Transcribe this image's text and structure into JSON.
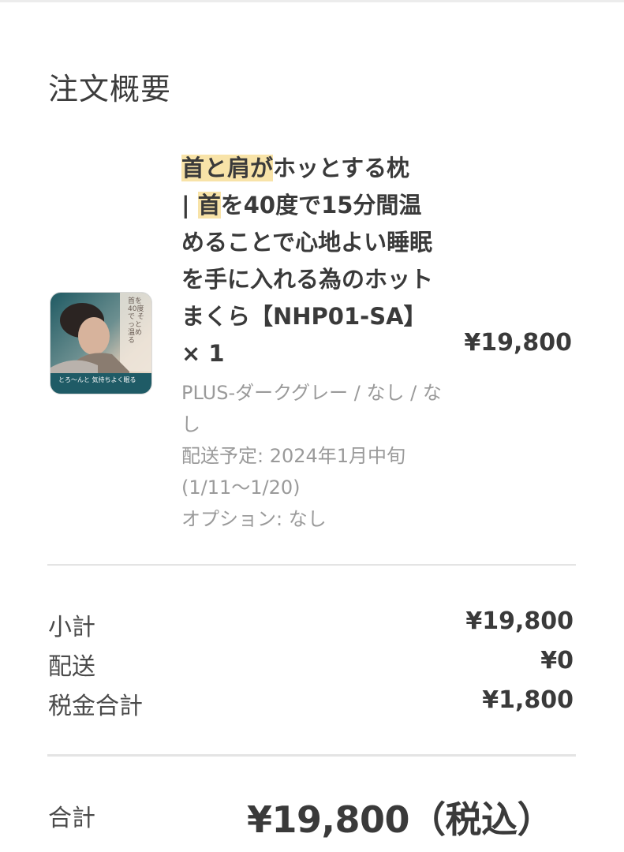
{
  "summary": {
    "title": "注文概要"
  },
  "item": {
    "name_hl1": "首と肩が",
    "name_part2": "ホッとする枕",
    "name_part3": "| ",
    "name_hl2": "首",
    "name_part4": "を40度で15分間温めることで心地よい睡眠を手に入れる為のホットまくら【NHP01-SA】 × 1",
    "variant": "PLUS-ダークグレー / なし / なし",
    "delivery": "配送予定: 2024年1月中旬 (1/11〜1/20)",
    "option": "オプション: なし",
    "price": "¥19,800",
    "thumbnail": {
      "overlay_text": "とろ〜んと 気持ちよく眠る",
      "side_text": "首を40度で そっと温める"
    }
  },
  "totals": {
    "subtotal_label": "小計",
    "subtotal_value": "¥19,800",
    "shipping_label": "配送",
    "shipping_value": "¥0",
    "tax_label": "税金合計",
    "tax_value": "¥1,800",
    "total_label": "合計",
    "total_value": "¥19,800（税込）"
  }
}
